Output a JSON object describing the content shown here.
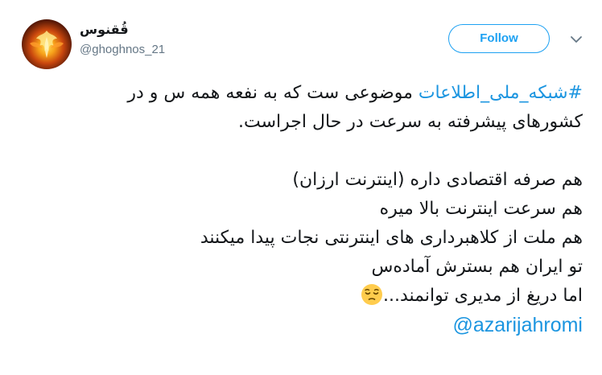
{
  "tweet": {
    "author": {
      "display_name": "قُقنوس",
      "handle": "@ghoghnos_21",
      "avatar_icon": "phoenix-avatar"
    },
    "follow_label": "Follow",
    "caret_icon": "chevron-down-icon",
    "body": {
      "hashtag": "#شبکه_ملی_اطلاعات",
      "line1_rest": " موضوعی ست که به نفعه همه س و در",
      "line2": "کشورهای پیشرفته به سرعت در حال اجراست.",
      "line3": "هم صرفه اقتصادی داره (اینترنت ارزان)",
      "line4": "هم سرعت اینترنت بالا میره",
      "line5": "هم ملت از کلاهبرداری های اینترنتی نجات پیدا میکنند",
      "line6": "تو ایران هم بسترش آماده‌س",
      "line7": "اما دریغ از مدیری توانمند...",
      "emoji_icon": "pensive-face-emoji",
      "mention": "@azarijahromi"
    }
  },
  "colors": {
    "link": "#1b95e0",
    "follow": "#1da1f2",
    "text": "#14171a",
    "secondary": "#657786"
  }
}
